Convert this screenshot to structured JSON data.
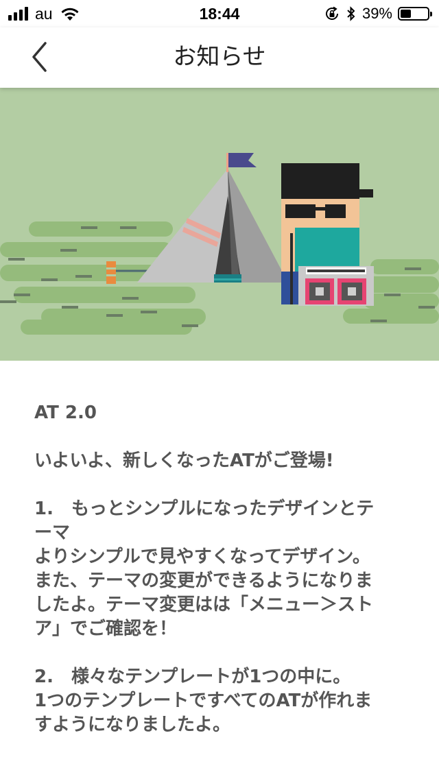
{
  "status_bar": {
    "carrier": "au",
    "time": "18:44",
    "battery_percent": "39%",
    "battery_level": 0.39,
    "icons": [
      "signal-bars-icon",
      "wifi-icon",
      "orientation-lock-icon",
      "bluetooth-icon",
      "battery-icon"
    ]
  },
  "nav": {
    "title": "お知らせ",
    "back_icon": "chevron-left-icon"
  },
  "hero": {
    "colors": {
      "background": "#b3cda3",
      "grass": "#95bb7c"
    }
  },
  "article": {
    "heading": "AT 2.0",
    "intro": "いよいよ、新しくなったATがご登場!",
    "section1_title_line1": "1.　もっとシンプルになったデザインとテ",
    "section1_title_line2": "ーマ",
    "section1_body_line1": "よりシンプルで見やすくなってデザイン。",
    "section1_body_line2": "また、テーマの変更ができるようになりま",
    "section1_body_line3": "したよ。テーマ変更はは「メニュー＞スト",
    "section1_body_line4": "ア」でご確認を！",
    "section2_title": "2.　様々なテンプレートが1つの中に。",
    "section2_body_line1": "1つのテンプレートですべてのATが作れま",
    "section2_body_line2": "すようになりましたよ。"
  }
}
